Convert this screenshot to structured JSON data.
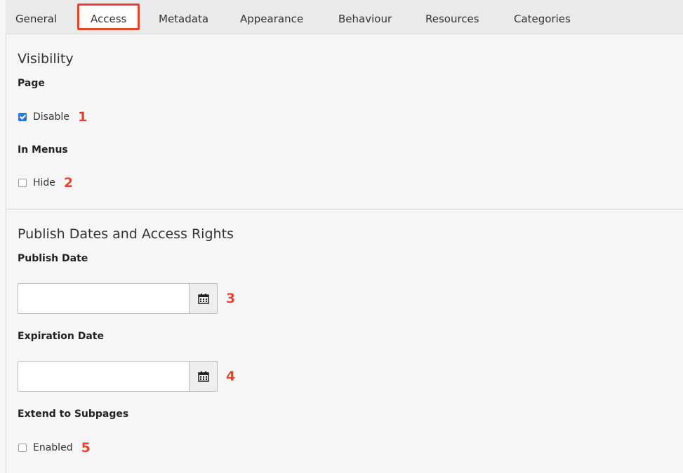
{
  "tabs": [
    {
      "label": "General",
      "active": false
    },
    {
      "label": "Access",
      "active": true
    },
    {
      "label": "Metadata",
      "active": false
    },
    {
      "label": "Appearance",
      "active": false
    },
    {
      "label": "Behaviour",
      "active": false
    },
    {
      "label": "Resources",
      "active": false
    },
    {
      "label": "Categories",
      "active": false
    }
  ],
  "visibility": {
    "title": "Visibility",
    "page_label": "Page",
    "disable": {
      "label": "Disable",
      "checked": true,
      "badge": "1"
    },
    "menus_label": "In Menus",
    "hide": {
      "label": "Hide",
      "checked": false,
      "badge": "2"
    }
  },
  "publish": {
    "title": "Publish Dates and Access Rights",
    "publish_date_label": "Publish Date",
    "publish_date_value": "",
    "publish_badge": "3",
    "expiration_date_label": "Expiration Date",
    "expiration_date_value": "",
    "expiration_badge": "4",
    "extend_label": "Extend to Subpages",
    "enabled": {
      "label": "Enabled",
      "checked": false,
      "badge": "5"
    }
  },
  "colors": {
    "accent_red": "#e8412c",
    "checkbox_blue": "#2d7ad6"
  },
  "icons": {
    "calendar": "calendar-icon"
  }
}
